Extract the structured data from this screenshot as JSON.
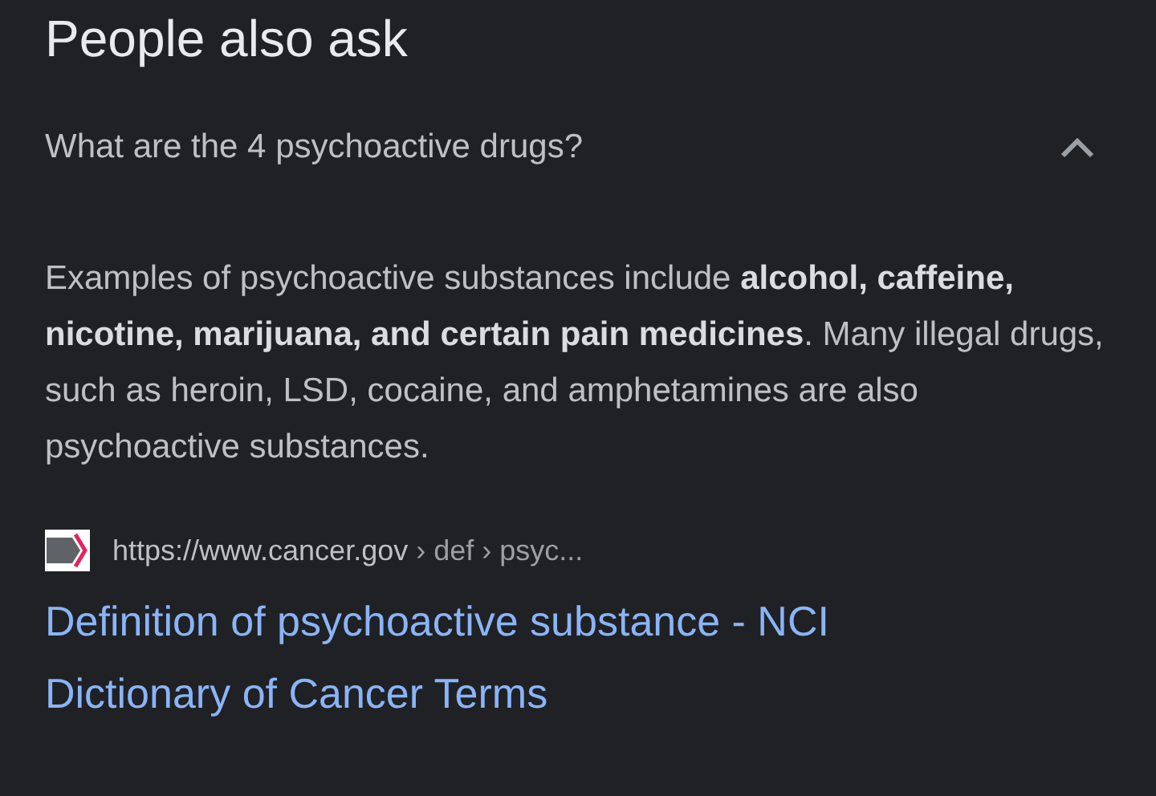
{
  "heading": "People also ask",
  "question": {
    "text": "What are the 4 psychoactive drugs?",
    "expanded": true
  },
  "answer": "Examples of psychoactive substances include **alcohol, caffeine, nicotine, marijuana, and certain pain medicines**. Many illegal drugs, such as heroin, LSD, cocaine, and amphetamines are also psychoactive substances.",
  "source": {
    "domain": "https://www.cancer.gov",
    "path": " › def › psyc...",
    "title": "Definition of psychoactive substance - NCI Dictionary of Cancer Terms"
  }
}
